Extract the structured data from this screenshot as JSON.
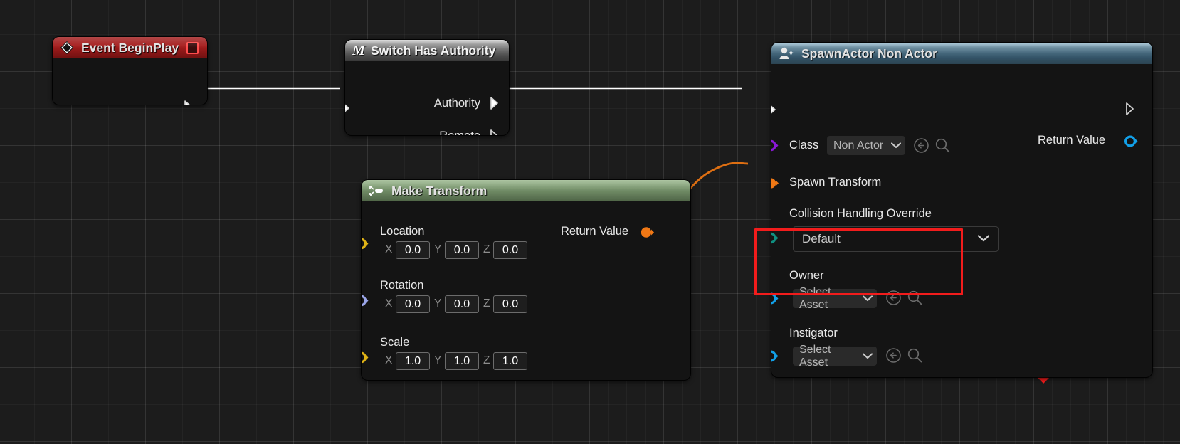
{
  "graph": {
    "background": "#1c1c1c",
    "grid_color": "#2a2a2a"
  },
  "nodes": [
    {
      "id": "event-begin-play",
      "title": "Event BeginPlay",
      "title_color": "#a61d1d",
      "icon": "event-diamond-icon",
      "badge": "delegate-badge",
      "outputs": [
        {
          "name": "exec-out",
          "label": "",
          "type": "exec"
        }
      ]
    },
    {
      "id": "switch-has-authority",
      "title": "Switch Has Authority",
      "title_color": "#8f8f8f",
      "icon": "multicast-m-icon",
      "icon_text": "M",
      "inputs": [
        {
          "name": "exec-in",
          "label": "",
          "type": "exec"
        }
      ],
      "outputs": [
        {
          "name": "authority",
          "label": "Authority",
          "type": "exec",
          "connected": true
        },
        {
          "name": "remote",
          "label": "Remote",
          "type": "exec",
          "connected": false
        }
      ]
    },
    {
      "id": "make-transform",
      "title": "Make Transform",
      "title_color": "#7e9b72",
      "icon": "make-struct-icon",
      "inputs": [
        {
          "name": "location",
          "label": "Location",
          "type": "vector",
          "color": "#e0b316",
          "axes": [
            {
              "axis": "X",
              "value": "0.0"
            },
            {
              "axis": "Y",
              "value": "0.0"
            },
            {
              "axis": "Z",
              "value": "0.0"
            }
          ]
        },
        {
          "name": "rotation",
          "label": "Rotation",
          "type": "rotator",
          "color": "#9aa5e8",
          "axes": [
            {
              "axis": "X",
              "value": "0.0"
            },
            {
              "axis": "Y",
              "value": "0.0"
            },
            {
              "axis": "Z",
              "value": "0.0"
            }
          ]
        },
        {
          "name": "scale",
          "label": "Scale",
          "type": "vector",
          "color": "#e0b316",
          "axes": [
            {
              "axis": "X",
              "value": "1.0"
            },
            {
              "axis": "Y",
              "value": "1.0"
            },
            {
              "axis": "Z",
              "value": "1.0"
            }
          ]
        }
      ],
      "outputs": [
        {
          "name": "return-value",
          "label": "Return Value",
          "type": "struct",
          "color": "#f07815",
          "connected": true
        }
      ]
    },
    {
      "id": "spawn-actor-non-actor",
      "title": "SpawnActor Non Actor",
      "title_color": "#5d8296",
      "icon": "spawn-actor-icon",
      "inputs": [
        {
          "name": "exec-in",
          "label": "",
          "type": "exec"
        },
        {
          "name": "class",
          "label": "Class",
          "type": "class",
          "color": "#8b18d8",
          "value": "Non Actor"
        },
        {
          "name": "spawn-transform",
          "label": "Spawn Transform",
          "type": "struct",
          "color": "#f07815",
          "connected": true
        },
        {
          "name": "collision-handling-override",
          "label": "Collision Handling Override",
          "type": "enum",
          "color": "#0f8f80",
          "value": "Default"
        },
        {
          "name": "owner",
          "label": "Owner",
          "type": "object",
          "color": "#12a0e8",
          "value": "Select Asset",
          "highlighted": true
        },
        {
          "name": "instigator",
          "label": "Instigator",
          "type": "object",
          "color": "#12a0e8",
          "value": "Select Asset"
        }
      ],
      "outputs": [
        {
          "name": "exec-out",
          "label": "",
          "type": "exec"
        },
        {
          "name": "return-value",
          "label": "Return Value",
          "type": "object",
          "color": "#12a0e8"
        }
      ],
      "collapse_icon": "chevron-up-icon"
    }
  ],
  "annotation": {
    "highlight_color": "#f21c1c",
    "arrow_color": "#f21c1c",
    "target": "owner",
    "shape": "arrow-pointing-up-left"
  }
}
